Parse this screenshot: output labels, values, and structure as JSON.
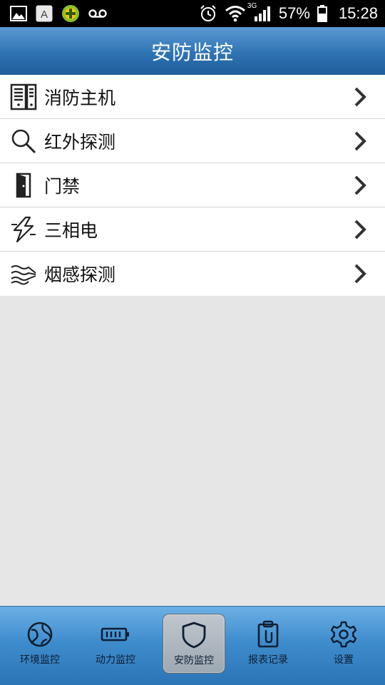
{
  "status_bar": {
    "network": "3G",
    "battery": "57%",
    "time": "15:28"
  },
  "header": {
    "title": "安防监控"
  },
  "list": [
    {
      "label": "消防主机",
      "icon": "fire-host-server-icon"
    },
    {
      "label": "红外探测",
      "icon": "magnifier-icon"
    },
    {
      "label": "门禁",
      "icon": "door-icon"
    },
    {
      "label": "三相电",
      "icon": "lightning-icon"
    },
    {
      "label": "烟感探测",
      "icon": "smoke-waves-icon"
    }
  ],
  "tabs": [
    {
      "label": "环境监控",
      "icon": "globe-icon",
      "active": false
    },
    {
      "label": "动力监控",
      "icon": "battery-icon",
      "active": false
    },
    {
      "label": "安防监控",
      "icon": "shield-icon",
      "active": true
    },
    {
      "label": "报表记录",
      "icon": "clipboard-icon",
      "active": false
    },
    {
      "label": "设置",
      "icon": "gear-icon",
      "active": false
    }
  ],
  "colors": {
    "header_blue": "#2f73b2",
    "nav_blue": "#3f8ccc",
    "background": "#e6e6e6"
  }
}
